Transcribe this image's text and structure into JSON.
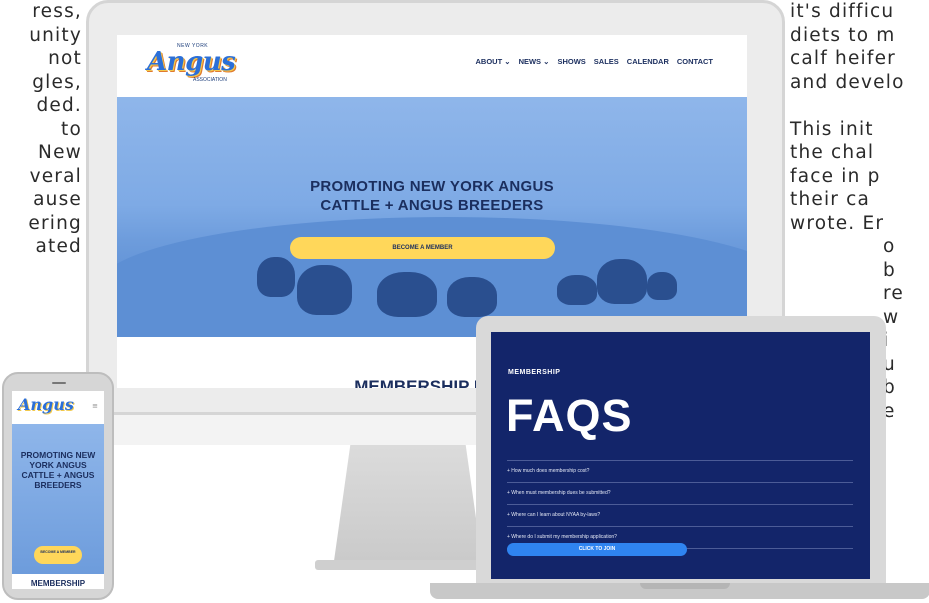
{
  "article_left": {
    "lines": [
      "ress,",
      "unity",
      "not",
      "gles,",
      "ded.",
      "to",
      "New",
      "veral",
      "ause",
      "ering",
      "ated"
    ]
  },
  "article_right": {
    "lines": [
      "it's difficu",
      "diets to m",
      "calf heifer",
      "and develo",
      "",
      "This   init",
      "the   chal",
      "face  in  p",
      "their     ca",
      "wrote. Er",
      "o",
      "b",
      "re",
      "w",
      "i",
      "u",
      "b",
      "e"
    ]
  },
  "desktop_site": {
    "logo_top": "NEW YORK",
    "logo_main": "Angus",
    "logo_bottom": "ASSOCIATION",
    "nav": [
      "ABOUT ⌄",
      "NEWS ⌄",
      "SHOWS",
      "SALES",
      "CALENDAR",
      "CONTACT"
    ],
    "hero_title_line1": "PROMOTING NEW YORK ANGUS",
    "hero_title_line2": "CATTLE + ANGUS BREEDERS",
    "hero_button": "BECOME A MEMBER",
    "section_peek": "MEMBERSHIP BEN"
  },
  "laptop_site": {
    "label": "MEMBERSHIP",
    "title": "FAQS",
    "faqs": [
      "+  How much does membership cost?",
      "+  When must membership dues be submitted?",
      "+  Where can I learn about NYAA by-laws?",
      "+  Where do I submit my membership application?"
    ],
    "button": "CLICK TO JOIN"
  },
  "phone_site": {
    "logo_main": "Angus",
    "menu_icon": "≡",
    "hero_title": "PROMOTING NEW YORK ANGUS CATTLE + ANGUS BREEDERS",
    "button": "BECOME A MEMBER",
    "section_peek": "MEMBERSHIP"
  },
  "colors": {
    "navy": "#13256a",
    "brand_blue": "#2b6fd8",
    "button_yellow": "#ffd75a",
    "button_blue": "#2f84f0"
  }
}
